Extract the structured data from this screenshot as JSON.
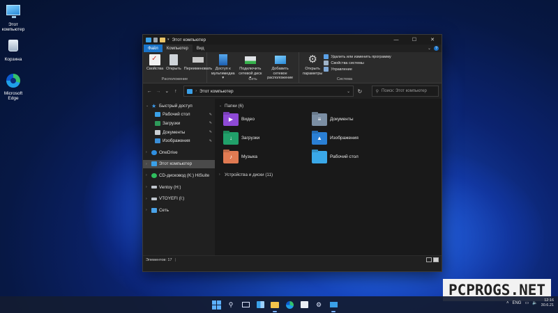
{
  "desktop": {
    "icons": [
      {
        "label_1": "Этот",
        "label_2": "компьютер"
      },
      {
        "label_1": "Корзина",
        "label_2": ""
      },
      {
        "label_1": "Microsoft",
        "label_2": "Edge"
      }
    ]
  },
  "window": {
    "title": "Этот компьютер",
    "controls": {
      "minimize": "—",
      "maximize": "☐",
      "close": "✕"
    },
    "ribbon_tabs": [
      "Файл",
      "Компьютер",
      "Вид"
    ],
    "ribbon": {
      "location_group": {
        "name": "Расположение",
        "buttons": [
          "Свойства",
          "Открыть",
          "Переименовать"
        ]
      },
      "network_group": {
        "name": "Сеть",
        "buttons": [
          {
            "l1": "Доступ к",
            "l2": "мультимедиа ▾"
          },
          {
            "l1": "Подключить",
            "l2": "сетевой диск ▾"
          },
          {
            "l1": "Добавить сетевое",
            "l2": "расположение"
          }
        ]
      },
      "system_group": {
        "name": "Система",
        "open_settings": {
          "l1": "Открыть",
          "l2": "параметры"
        },
        "small_buttons": [
          "Удалить или изменить программу",
          "Свойства системы",
          "Управление"
        ]
      }
    },
    "address": {
      "path": "Этот компьютер",
      "search_placeholder": "Поиск: Этот компьютер"
    },
    "nav": {
      "quick_access": "Быстрый доступ",
      "quick_items": [
        "Рабочий стол",
        "Загрузки",
        "Документы",
        "Изображения"
      ],
      "onedrive": "OneDrive",
      "this_pc": "Этот компьютер",
      "cd_drive": "CD-дисковод (K:) HiSuite",
      "ventoy": "Ventoy (H:)",
      "vtoyefi": "VTOYEFI (I:)",
      "network": "Сеть"
    },
    "content": {
      "folders_header": "Папки (6)",
      "folders": [
        "Видео",
        "Документы",
        "Загрузки",
        "Изображения",
        "Музыка",
        "Рабочий стол"
      ],
      "drives_header": "Устройства и диски (11)"
    },
    "status": {
      "items": "Элементов: 17"
    }
  },
  "watermark": "PCPROGS.NET",
  "taskbar": {
    "lang": "ENG",
    "time": "12:16",
    "date": "30.6.21"
  }
}
